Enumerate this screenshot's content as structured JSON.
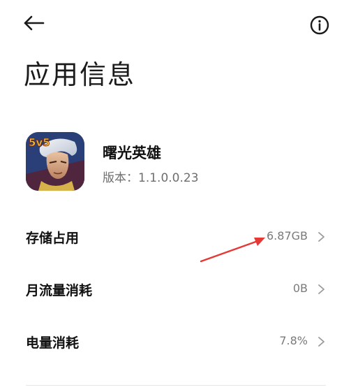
{
  "page": {
    "title": "应用信息"
  },
  "app": {
    "name": "曙光英雄",
    "version": "版本：1.1.0.0.23",
    "icon_badge": "5v5"
  },
  "rows": [
    {
      "label": "存储占用",
      "value": "6.87GB"
    },
    {
      "label": "月流量消耗",
      "value": "0B"
    },
    {
      "label": "电量消耗",
      "value": "7.8%"
    }
  ],
  "icons": {
    "back": "back-arrow-icon",
    "info": "info-icon",
    "chevron": "chevron-right-icon"
  },
  "colors": {
    "annotation": "#e53935",
    "text_primary": "#111111",
    "text_secondary": "#7a7a7a"
  }
}
